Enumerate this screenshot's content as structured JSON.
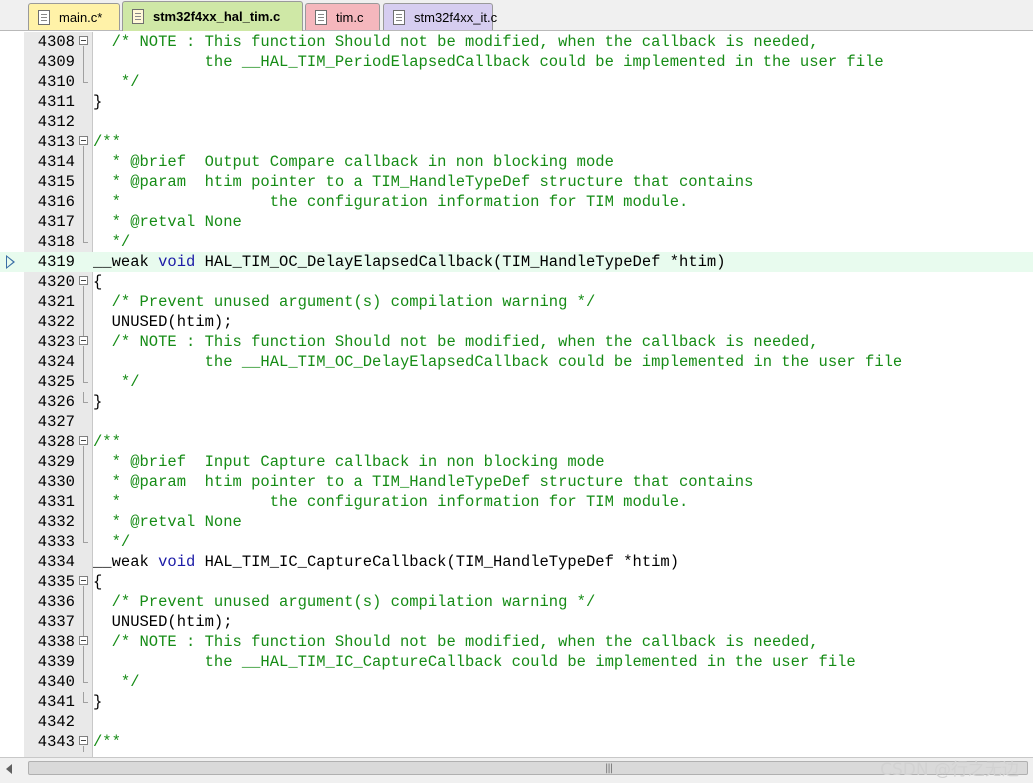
{
  "tabs": [
    {
      "label": "main.c*",
      "bg": "#fff2a8",
      "icon": "c-file-icon"
    },
    {
      "label": "stm32f4xx_hal_tim.c",
      "bg": "#cfe8a6",
      "icon": "c-file-icon",
      "active": true
    },
    {
      "label": "tim.c",
      "bg": "#f5b7bd",
      "icon": "c-file-icon"
    },
    {
      "label": "stm32f4xx_it.c",
      "bg": "#d6cdf0",
      "icon": "c-file-icon"
    }
  ],
  "editor": {
    "current_line": 4319,
    "lines": [
      {
        "num": "4308",
        "fold": "open",
        "tokens": [
          [
            "  /* NOTE : This function Should not be modified, when the callback is needed,",
            "c"
          ]
        ]
      },
      {
        "num": "4309",
        "fold": "line",
        "tokens": [
          [
            "            the __HAL_TIM_PeriodElapsedCallback could be implemented in the user file",
            "c"
          ]
        ]
      },
      {
        "num": "4310",
        "fold": "end",
        "tokens": [
          [
            "   */",
            "c"
          ]
        ]
      },
      {
        "num": "4311",
        "fold": "none",
        "tokens": [
          [
            "}",
            "n"
          ]
        ]
      },
      {
        "num": "4312",
        "fold": "none",
        "tokens": [
          [
            "",
            "n"
          ]
        ]
      },
      {
        "num": "4313",
        "fold": "open",
        "tokens": [
          [
            "/**",
            "c"
          ]
        ]
      },
      {
        "num": "4314",
        "fold": "line",
        "tokens": [
          [
            "  * @brief  Output Compare callback in non blocking mode",
            "c"
          ]
        ]
      },
      {
        "num": "4315",
        "fold": "line",
        "tokens": [
          [
            "  * @param  htim pointer to a TIM_HandleTypeDef structure that contains",
            "c"
          ]
        ]
      },
      {
        "num": "4316",
        "fold": "line",
        "tokens": [
          [
            "  *                the configuration information for TIM module.",
            "c"
          ]
        ]
      },
      {
        "num": "4317",
        "fold": "line",
        "tokens": [
          [
            "  * @retval None",
            "c"
          ]
        ]
      },
      {
        "num": "4318",
        "fold": "end",
        "tokens": [
          [
            "  */",
            "c"
          ]
        ]
      },
      {
        "num": "4319",
        "fold": "none",
        "tokens": [
          [
            "__weak ",
            "n"
          ],
          [
            "void",
            "k"
          ],
          [
            " HAL_TIM_OC_DelayElapsedCallback(TIM_HandleTypeDef *htim)",
            "n"
          ]
        ]
      },
      {
        "num": "4320",
        "fold": "open",
        "tokens": [
          [
            "{",
            "n"
          ]
        ]
      },
      {
        "num": "4321",
        "fold": "line",
        "tokens": [
          [
            "  /* Prevent unused argument(s) compilation warning */",
            "c"
          ]
        ]
      },
      {
        "num": "4322",
        "fold": "line",
        "tokens": [
          [
            "  UNUSED(htim);",
            "n"
          ]
        ]
      },
      {
        "num": "4323",
        "fold": "open",
        "tokens": [
          [
            "  /* NOTE : This function Should not be modified, when the callback is needed,",
            "c"
          ]
        ]
      },
      {
        "num": "4324",
        "fold": "line",
        "tokens": [
          [
            "            the __HAL_TIM_OC_DelayElapsedCallback could be implemented in the user file",
            "c"
          ]
        ]
      },
      {
        "num": "4325",
        "fold": "end",
        "tokens": [
          [
            "   */",
            "c"
          ]
        ]
      },
      {
        "num": "4326",
        "fold": "end",
        "tokens": [
          [
            "}",
            "n"
          ]
        ]
      },
      {
        "num": "4327",
        "fold": "none",
        "tokens": [
          [
            "",
            "n"
          ]
        ]
      },
      {
        "num": "4328",
        "fold": "open",
        "tokens": [
          [
            "/**",
            "c"
          ]
        ]
      },
      {
        "num": "4329",
        "fold": "line",
        "tokens": [
          [
            "  * @brief  Input Capture callback in non blocking mode",
            "c"
          ]
        ]
      },
      {
        "num": "4330",
        "fold": "line",
        "tokens": [
          [
            "  * @param  htim pointer to a TIM_HandleTypeDef structure that contains",
            "c"
          ]
        ]
      },
      {
        "num": "4331",
        "fold": "line",
        "tokens": [
          [
            "  *                the configuration information for TIM module.",
            "c"
          ]
        ]
      },
      {
        "num": "4332",
        "fold": "line",
        "tokens": [
          [
            "  * @retval None",
            "c"
          ]
        ]
      },
      {
        "num": "4333",
        "fold": "end",
        "tokens": [
          [
            "  */",
            "c"
          ]
        ]
      },
      {
        "num": "4334",
        "fold": "none",
        "tokens": [
          [
            "__weak ",
            "n"
          ],
          [
            "void",
            "k"
          ],
          [
            " HAL_TIM_IC_CaptureCallback(TIM_HandleTypeDef *htim)",
            "n"
          ]
        ]
      },
      {
        "num": "4335",
        "fold": "open",
        "tokens": [
          [
            "{",
            "n"
          ]
        ]
      },
      {
        "num": "4336",
        "fold": "line",
        "tokens": [
          [
            "  /* Prevent unused argument(s) compilation warning */",
            "c"
          ]
        ]
      },
      {
        "num": "4337",
        "fold": "line",
        "tokens": [
          [
            "  UNUSED(htim);",
            "n"
          ]
        ]
      },
      {
        "num": "4338",
        "fold": "open",
        "tokens": [
          [
            "  /* NOTE : This function Should not be modified, when the callback is needed,",
            "c"
          ]
        ]
      },
      {
        "num": "4339",
        "fold": "line",
        "tokens": [
          [
            "            the __HAL_TIM_IC_CaptureCallback could be implemented in the user file",
            "c"
          ]
        ]
      },
      {
        "num": "4340",
        "fold": "end",
        "tokens": [
          [
            "   */",
            "c"
          ]
        ]
      },
      {
        "num": "4341",
        "fold": "end",
        "tokens": [
          [
            "}",
            "n"
          ]
        ]
      },
      {
        "num": "4342",
        "fold": "none",
        "tokens": [
          [
            "",
            "n"
          ]
        ]
      },
      {
        "num": "4343",
        "fold": "open",
        "tokens": [
          [
            "/**",
            "c"
          ]
        ]
      }
    ]
  },
  "scrollbar": {
    "grip_icon": "grip-icon",
    "grip_glyph": "|||"
  },
  "watermark": "CSDN @行之无边",
  "colors": {
    "comment": "#168c16",
    "keyword": "#1a1aa6",
    "current_line_bg": "#e8fbee"
  }
}
